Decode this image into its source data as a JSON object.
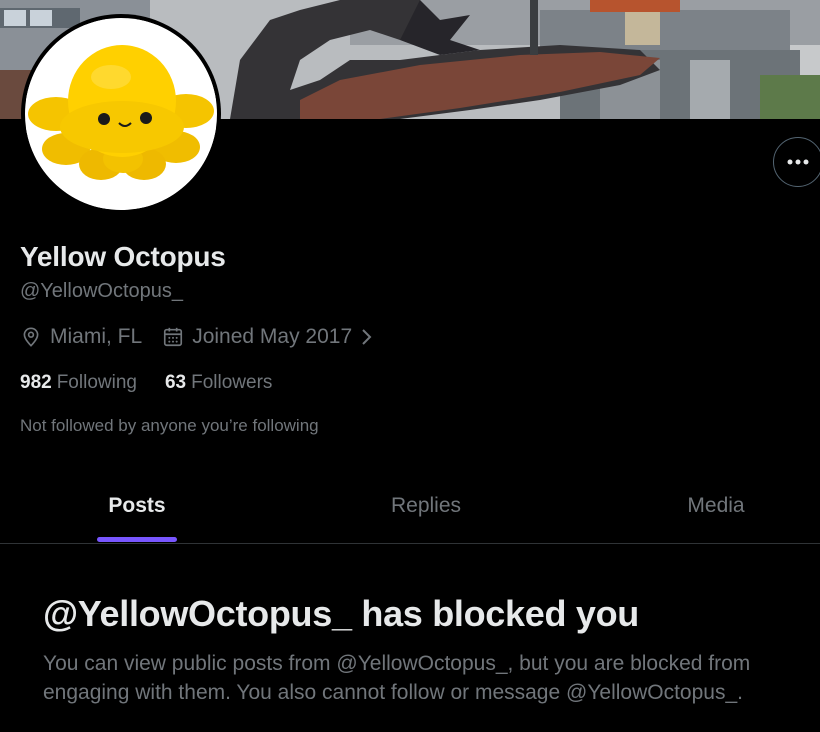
{
  "profile": {
    "name": "Yellow Octopus",
    "handle": "@YellowOctopus_",
    "location": "Miami, FL",
    "joined": "Joined May 2017",
    "following_count": "982",
    "following_label": "Following",
    "followers_count": "63",
    "followers_label": "Followers",
    "followed_note": "Not followed by anyone you’re following"
  },
  "tabs": [
    {
      "label": "Posts",
      "active": true
    },
    {
      "label": "Replies",
      "active": false
    },
    {
      "label": "Media",
      "active": false
    }
  ],
  "blocked": {
    "title": "@YellowOctopus_ has blocked you",
    "description": "You can view public posts from @YellowOctopus_, but you are blocked from engaging with them. You also cannot follow or message @YellowOctopus_."
  },
  "icons": {
    "more": "more-horizontal-icon",
    "location": "location-pin-icon",
    "calendar": "calendar-icon",
    "chevron": "chevron-right-icon"
  },
  "colors": {
    "background": "#000000",
    "primary_text": "#e7e9ea",
    "secondary_text": "#71767b",
    "tab_indicator": "#7856ff",
    "divider": "#2f3336"
  }
}
